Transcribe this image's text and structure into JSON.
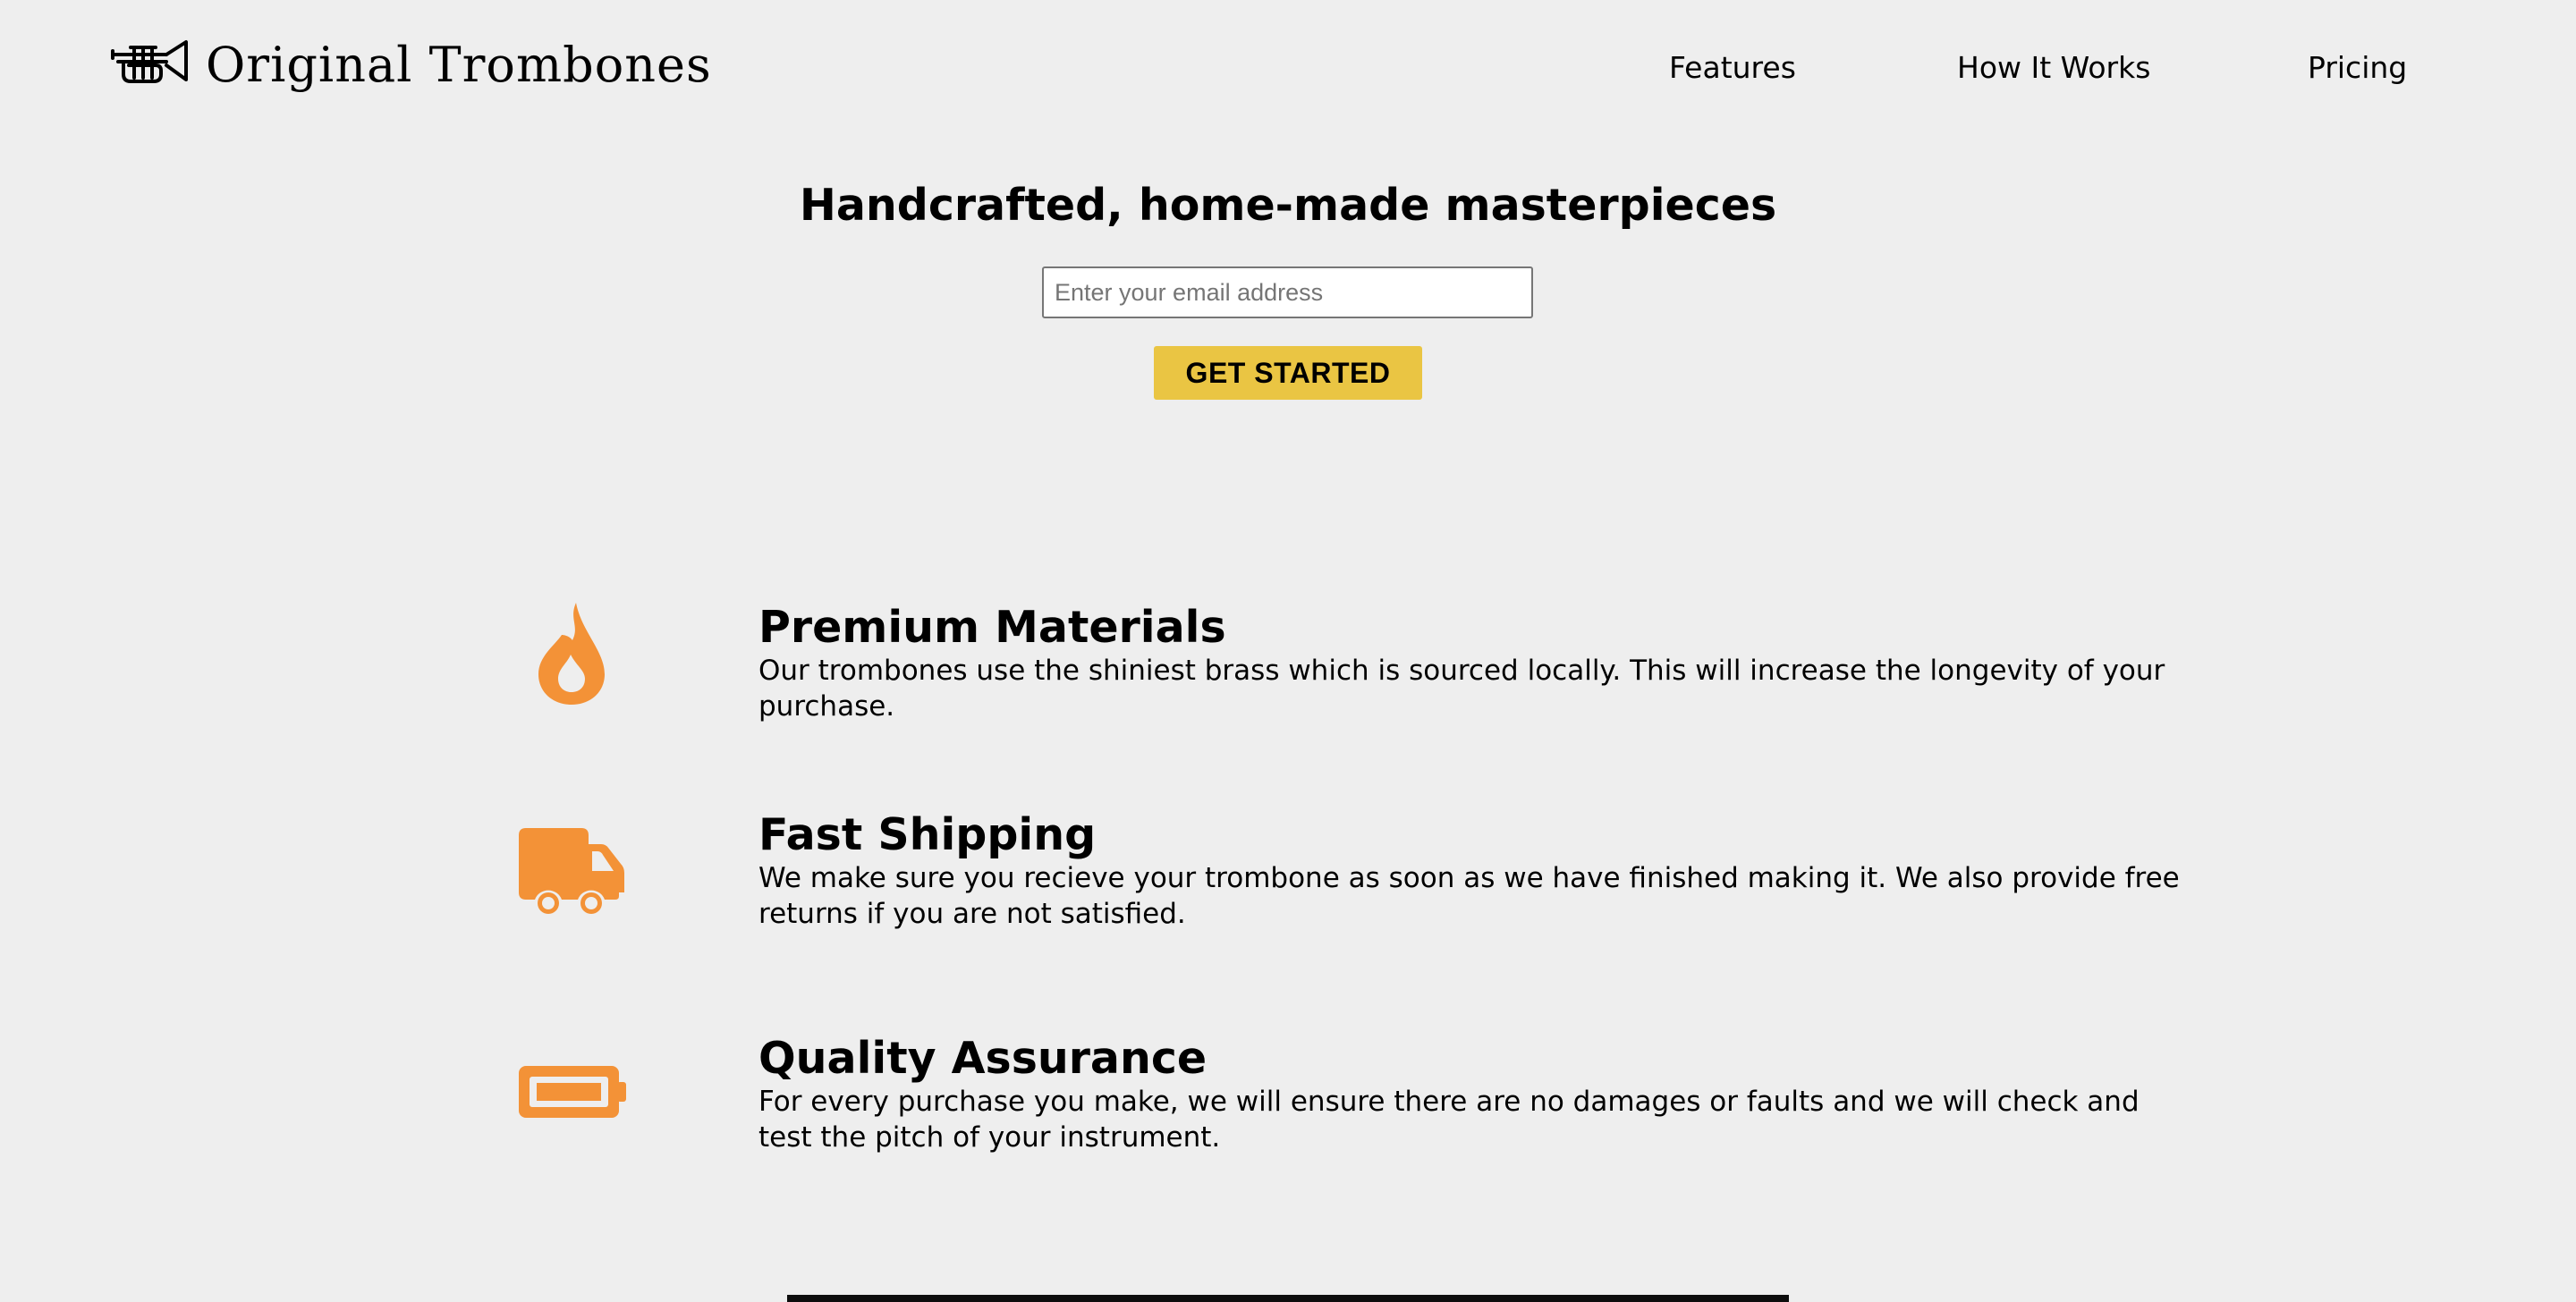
{
  "header": {
    "logo_text": "Original Trombones",
    "logo_icon": "trumpet-icon",
    "nav": [
      {
        "label": "Features"
      },
      {
        "label": "How It Works"
      },
      {
        "label": "Pricing"
      }
    ]
  },
  "hero": {
    "title": "Handcrafted, home-made masterpieces",
    "email_placeholder": "Enter your email address",
    "email_value": "",
    "cta_label": "GET STARTED"
  },
  "features": [
    {
      "icon": "fire-icon",
      "title": "Premium Materials",
      "description": "Our trombones use the shiniest brass which is sourced locally. This will increase the longevity of your purchase."
    },
    {
      "icon": "truck-icon",
      "title": "Fast Shipping",
      "description": "We make sure you recieve your trombone as soon as we have finished making it. We also provide free returns if you are not satisfied."
    },
    {
      "icon": "battery-full-icon",
      "title": "Quality Assurance",
      "description": "For every purchase you make, we will ensure there are no damages or faults and we will check and test the pitch of your instrument."
    }
  ],
  "colors": {
    "background": "#eeeeee",
    "accent_orange": "#f39237",
    "button_yellow": "#eac543",
    "text": "#000000"
  }
}
